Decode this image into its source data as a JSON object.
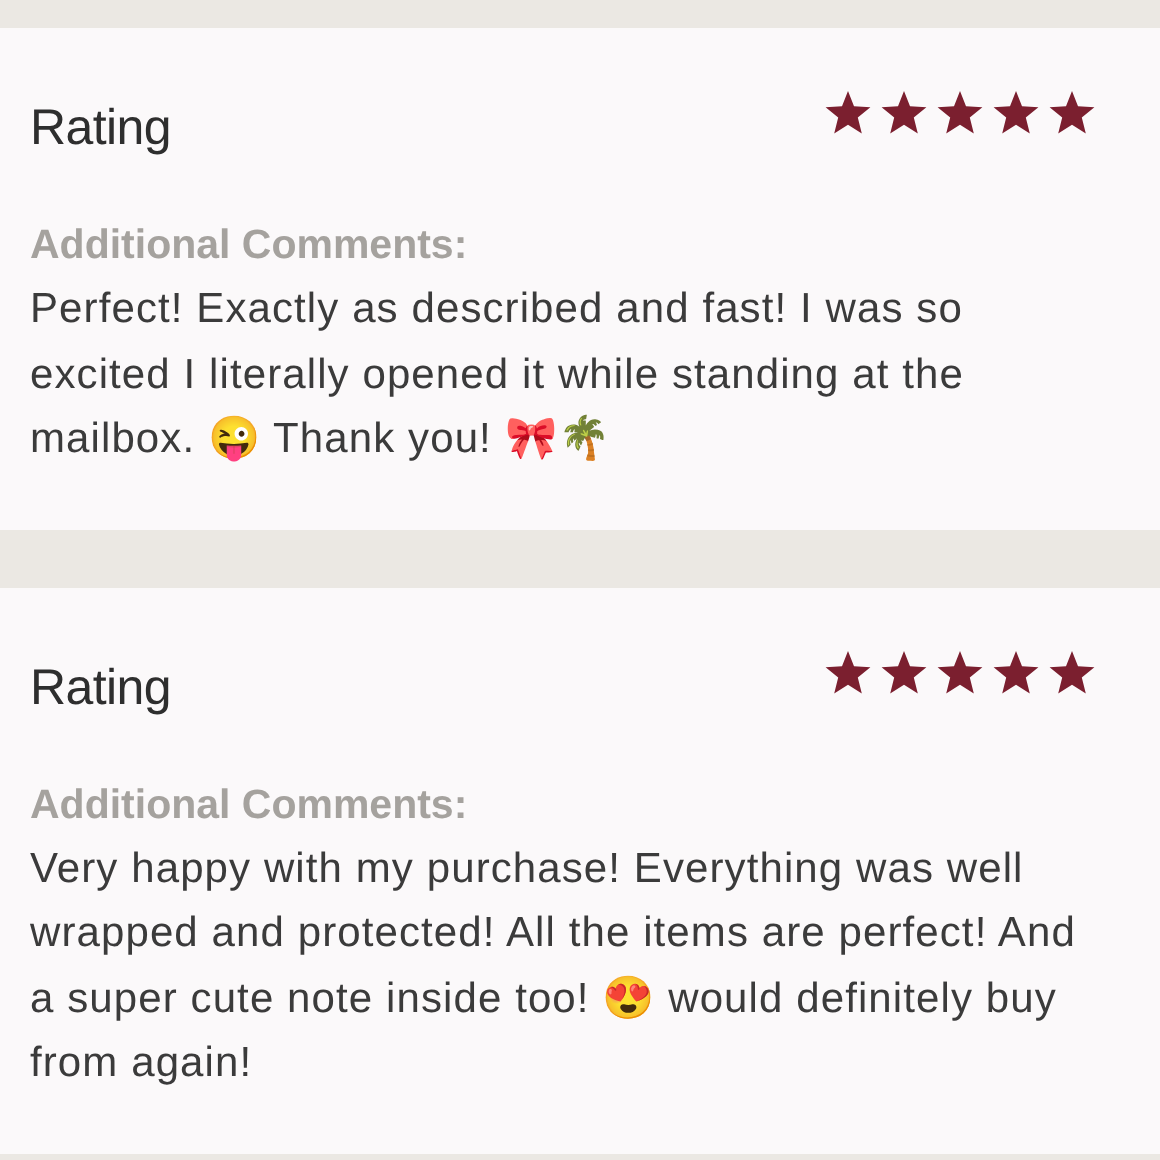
{
  "reviews": [
    {
      "heading": "Rating",
      "stars": 5,
      "comments_label": "Additional Comments:",
      "comment": "Perfect! Exactly as described and fast! I was so excited I literally opened it while standing at the mailbox. 😜 Thank you! 🎀🌴"
    },
    {
      "heading": "Rating",
      "stars": 5,
      "comments_label": "Additional Comments:",
      "comment": "Very happy with my purchase! Everything was well wrapped and protected! All the items are perfect! And a super cute note inside too! 😍 would definitely buy from again!"
    }
  ]
}
